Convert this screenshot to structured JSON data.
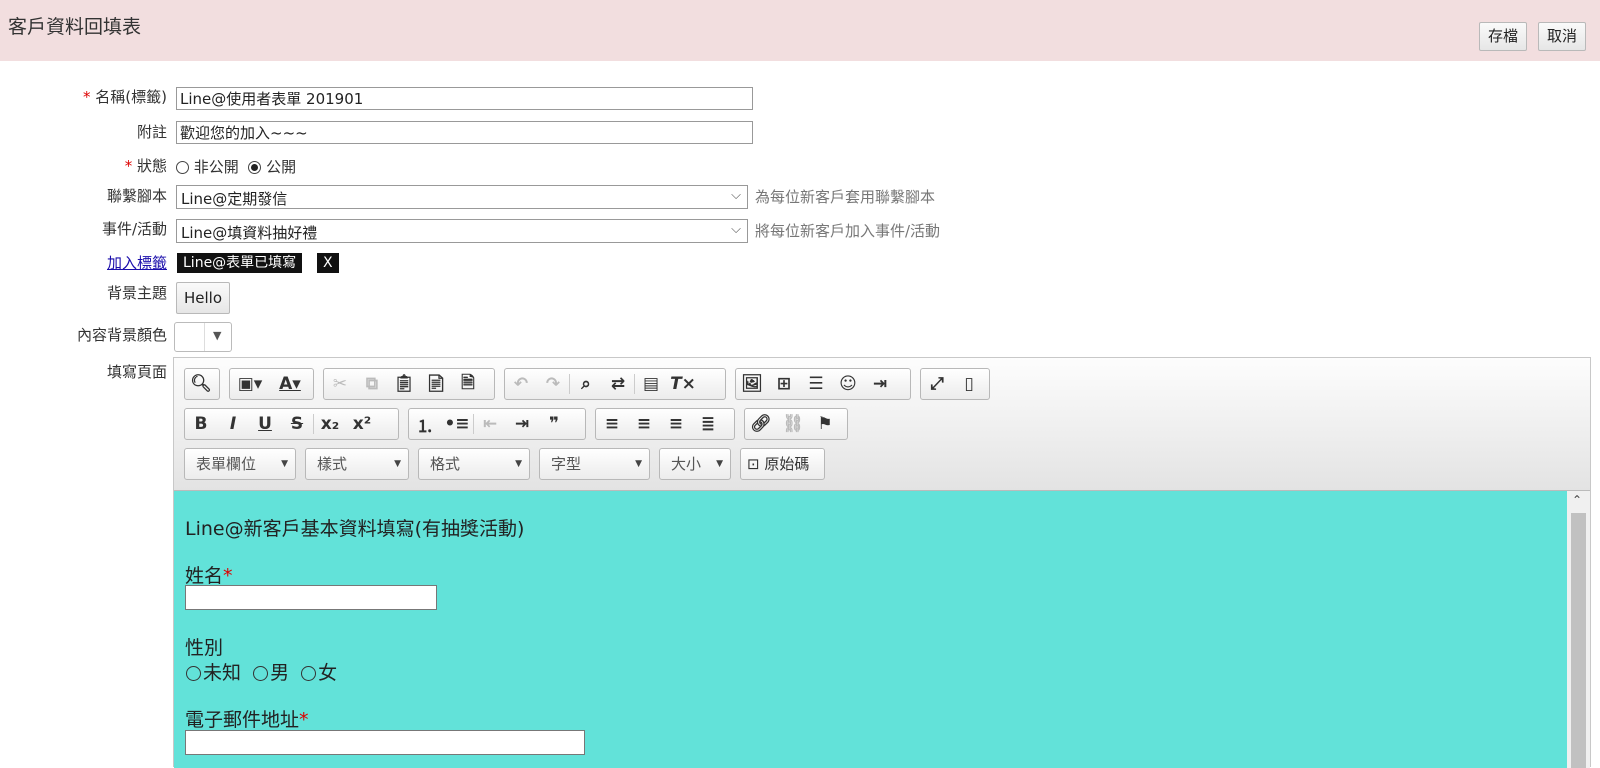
{
  "header": {
    "title": "客戶資料回填表",
    "save_label": "存檔",
    "cancel_label": "取消"
  },
  "form": {
    "name_label": "名稱(標籤)",
    "name_value": "Line@使用者表單 201901",
    "note_label": "附註",
    "note_value": "歡迎您的加入~~~",
    "status_label": "狀態",
    "status_options": [
      "非公開",
      "公開"
    ],
    "status_selected": "公開",
    "script_label": "聯繫腳本",
    "script_value": "Line@定期發信",
    "script_hint": "為每位新客戶套用聯繫腳本",
    "event_label": "事件/活動",
    "event_value": "Line@填資料抽好禮",
    "event_hint": "將每位新客戶加入事件/活動",
    "add_tag_label": "加入標籤",
    "tag_value": "Line@表單已填寫",
    "tag_remove": "X",
    "theme_label": "背景主題",
    "theme_button": "Hello",
    "bgcolor_label": "內容背景顏色",
    "page_label": "填寫頁面"
  },
  "editor": {
    "combos": [
      "表單欄位",
      "樣式",
      "格式",
      "字型",
      "大小"
    ],
    "source_label": "原始碼",
    "content": {
      "title": "Line@新客戶基本資料填寫(有抽獎活動)",
      "name_label": "姓名",
      "gender_label": "性別",
      "gender_options": [
        "未知",
        "男",
        "女"
      ],
      "email_label": "電子郵件地址",
      "required_mark": "*"
    },
    "background_color": "#62e2d9"
  },
  "colors": {
    "header_bg": "#f2dedf",
    "required": "#dd0000",
    "link": "#1a0dab"
  }
}
